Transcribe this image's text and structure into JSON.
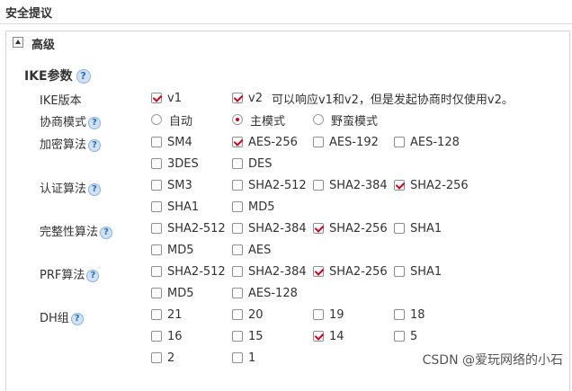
{
  "section_title": "安全提议",
  "panel": {
    "label": "高级"
  },
  "ike": {
    "title": "IKE参数",
    "rows": {
      "version": {
        "label": "IKE版本",
        "options": [
          {
            "text": "v1",
            "checked": true
          },
          {
            "text": "v2",
            "checked": true
          }
        ],
        "note": "可以响应v1和v2，但是发起协商时仅使用v2。"
      },
      "mode": {
        "label": "协商模式",
        "options": [
          {
            "text": "自动",
            "checked": false
          },
          {
            "text": "主模式",
            "checked": true
          },
          {
            "text": "野蛮模式",
            "checked": false
          }
        ]
      },
      "encryption": {
        "label": "加密算法",
        "options": [
          {
            "text": "SM4",
            "checked": false
          },
          {
            "text": "AES-256",
            "checked": true
          },
          {
            "text": "AES-192",
            "checked": false
          },
          {
            "text": "AES-128",
            "checked": false
          },
          {
            "text": "3DES",
            "checked": false
          },
          {
            "text": "DES",
            "checked": false
          }
        ]
      },
      "auth": {
        "label": "认证算法",
        "options": [
          {
            "text": "SM3",
            "checked": false
          },
          {
            "text": "SHA2-512",
            "checked": false
          },
          {
            "text": "SHA2-384",
            "checked": false
          },
          {
            "text": "SHA2-256",
            "checked": true
          },
          {
            "text": "SHA1",
            "checked": false
          },
          {
            "text": "MD5",
            "checked": false
          }
        ]
      },
      "integrity": {
        "label": "完整性算法",
        "options": [
          {
            "text": "SHA2-512",
            "checked": false
          },
          {
            "text": "SHA2-384",
            "checked": false
          },
          {
            "text": "SHA2-256",
            "checked": true
          },
          {
            "text": "SHA1",
            "checked": false
          },
          {
            "text": "MD5",
            "checked": false
          },
          {
            "text": "AES",
            "checked": false
          }
        ]
      },
      "prf": {
        "label": "PRF算法",
        "options": [
          {
            "text": "SHA2-512",
            "checked": false
          },
          {
            "text": "SHA2-384",
            "checked": false
          },
          {
            "text": "SHA2-256",
            "checked": true
          },
          {
            "text": "SHA1",
            "checked": false
          },
          {
            "text": "MD5",
            "checked": false
          },
          {
            "text": "AES-128",
            "checked": false
          }
        ]
      },
      "dh": {
        "label": "DH组",
        "options": [
          {
            "text": "21",
            "checked": false
          },
          {
            "text": "20",
            "checked": false
          },
          {
            "text": "19",
            "checked": false
          },
          {
            "text": "18",
            "checked": false
          },
          {
            "text": "16",
            "checked": false
          },
          {
            "text": "15",
            "checked": false
          },
          {
            "text": "14",
            "checked": true
          },
          {
            "text": "5",
            "checked": false
          },
          {
            "text": "2",
            "checked": false
          },
          {
            "text": "1",
            "checked": false
          }
        ]
      }
    }
  },
  "help_icon_glyph": "?",
  "watermark": "CSDN @爱玩网络的小石",
  "colors": {
    "check_red": "#d0021b",
    "help_blue": "#2f6db5",
    "border": "#d4d4d4"
  }
}
